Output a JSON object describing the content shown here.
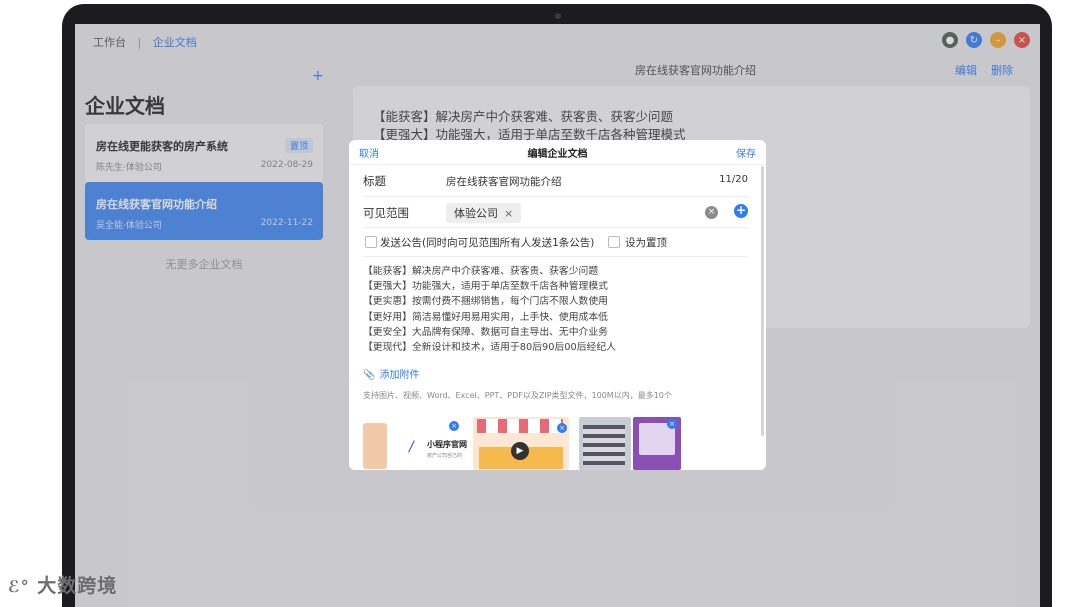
{
  "breadcrumb": {
    "home": "工作台",
    "current": "企业文档"
  },
  "left": {
    "add_symbol": "+",
    "title": "企业文档",
    "cards": [
      {
        "title": "房在线更能获客的房产系统",
        "badge": "置顶",
        "author": "陈先生·体验公司",
        "date": "2022-08-29"
      },
      {
        "title": "房在线获客官网功能介绍",
        "author": "吴全能·体验公司",
        "date": "2022-11-22"
      }
    ],
    "no_more": "无更多企业文档"
  },
  "right": {
    "doc_title": "房在线获客官网功能介绍",
    "edit": "编辑",
    "delete": "删除",
    "lines": [
      "【能获客】解决房产中介获客难、获客贵、获客少问题",
      "【更强大】功能强大，适用于单店至数千店各种管理模式"
    ]
  },
  "dialog": {
    "cancel": "取消",
    "title": "编辑企业文档",
    "save": "保存",
    "title_label": "标题",
    "title_value": "房在线获客官网功能介绍",
    "title_count": "11/20",
    "scope_label": "可见范围",
    "scope_tag": "体验公司",
    "tag_close": "×",
    "clear_symbol": "×",
    "add_symbol": "+",
    "announce_label": "发送公告(同时向可见范围所有人发送1条公告)",
    "pin_label": "设为置顶",
    "body_lines": [
      "【能获客】解决房产中介获客难、获客贵、获客少问题",
      "【更强大】功能强大，适用于单店至数千店各种管理模式",
      "【更实惠】按需付费不捆绑销售，每个门店不限人数使用",
      "【更好用】简洁易懂好用易用实用，上手快、使用成本低",
      "【更安全】大品牌有保障、数据可自主导出、无中介业务",
      "【更现代】全新设计和技术，适用于80后90后00后经纪人"
    ],
    "attach_label": "添加附件",
    "attach_hint": "支持图片、视频、Word、Excel、PPT、PDF以及ZIP类型文件，100M以内，最多10个",
    "thumb2_caption": "小程序官网",
    "thumb2_sub": "房产公司自己的"
  },
  "watermark": "大数跨境",
  "colors": {
    "accent": "#2f7cf6",
    "selected_card": "#3d86f1",
    "orange": "#f5a623",
    "red": "#e8453c"
  }
}
